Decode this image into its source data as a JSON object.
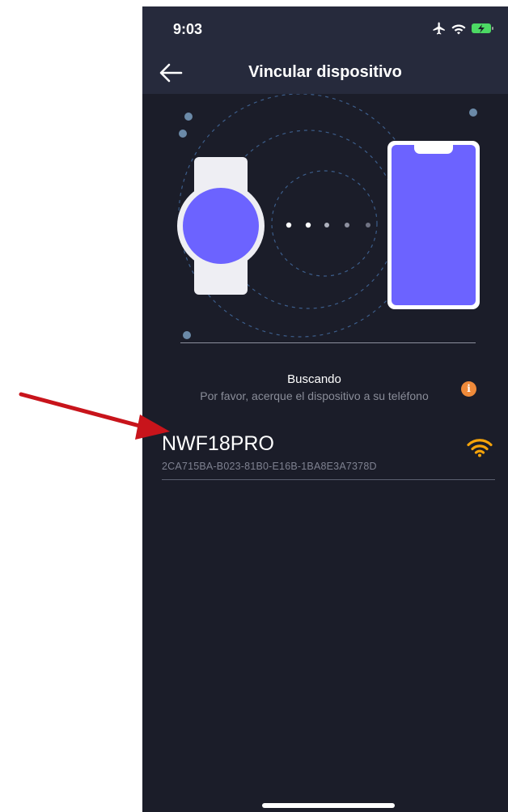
{
  "status_bar": {
    "time": "9:03",
    "icons": [
      "airplane-icon",
      "wifi-icon",
      "battery-charging-icon"
    ],
    "battery_color": "#4cd964"
  },
  "nav": {
    "title": "Vincular dispositivo",
    "back_icon": "arrow-left-icon"
  },
  "illustration": {
    "watch_face_color": "#6c63ff",
    "phone_screen_color": "#6c63ff",
    "connection_dots": 5
  },
  "search": {
    "title": "Buscando",
    "subtitle": "Por favor, acerque el dispositivo a su teléfono",
    "info_icon": "info-icon",
    "info_color": "#ef8a3a"
  },
  "devices": [
    {
      "name": "NWF18PRO",
      "id": "2CA715BA-B023-81B0-E16B-1BA8E3A7378D",
      "signal_icon": "wifi-signal-icon",
      "signal_color": "#f5a30a"
    }
  ],
  "annotation": {
    "arrow_color": "#c8141b"
  }
}
